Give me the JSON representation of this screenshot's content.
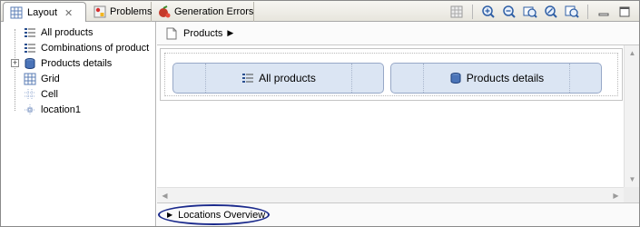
{
  "tabs": [
    {
      "label": "Layout",
      "icon": "layout-grid-icon",
      "active": true,
      "close": "✕"
    },
    {
      "label": "Problems",
      "icon": "problems-icon",
      "active": false
    },
    {
      "label": "Generation Errors",
      "icon": "generation-errors-icon",
      "active": false
    }
  ],
  "tree": {
    "items": [
      {
        "label": "All products",
        "icon": "list-icon"
      },
      {
        "label": "Combinations of product",
        "icon": "list-icon"
      },
      {
        "label": "Products details",
        "icon": "database-icon",
        "expander": "+"
      },
      {
        "label": "Grid",
        "icon": "grid-icon"
      },
      {
        "label": "Cell",
        "icon": "cell-icon"
      },
      {
        "label": "location1",
        "icon": "location-icon"
      }
    ]
  },
  "editor": {
    "breadcrumb": {
      "label": "Products",
      "icon": "page-icon",
      "arrow": "▶"
    },
    "cells": [
      {
        "label": "All products",
        "icon": "list-icon"
      },
      {
        "label": "Products details",
        "icon": "database-icon"
      }
    ],
    "locations": {
      "label": "Locations Overview",
      "arrow": "▶"
    }
  },
  "toolbar": {
    "buttons": [
      "grid-toggle-icon",
      "zoom-in-icon",
      "zoom-out-icon",
      "zoom-fit-icon",
      "zoom-custom-icon",
      "zoom-page-icon",
      "minimize-icon",
      "maximize-icon"
    ]
  },
  "colors": {
    "accent": "#dbe5f3",
    "highlight": "#1b2a8c"
  }
}
